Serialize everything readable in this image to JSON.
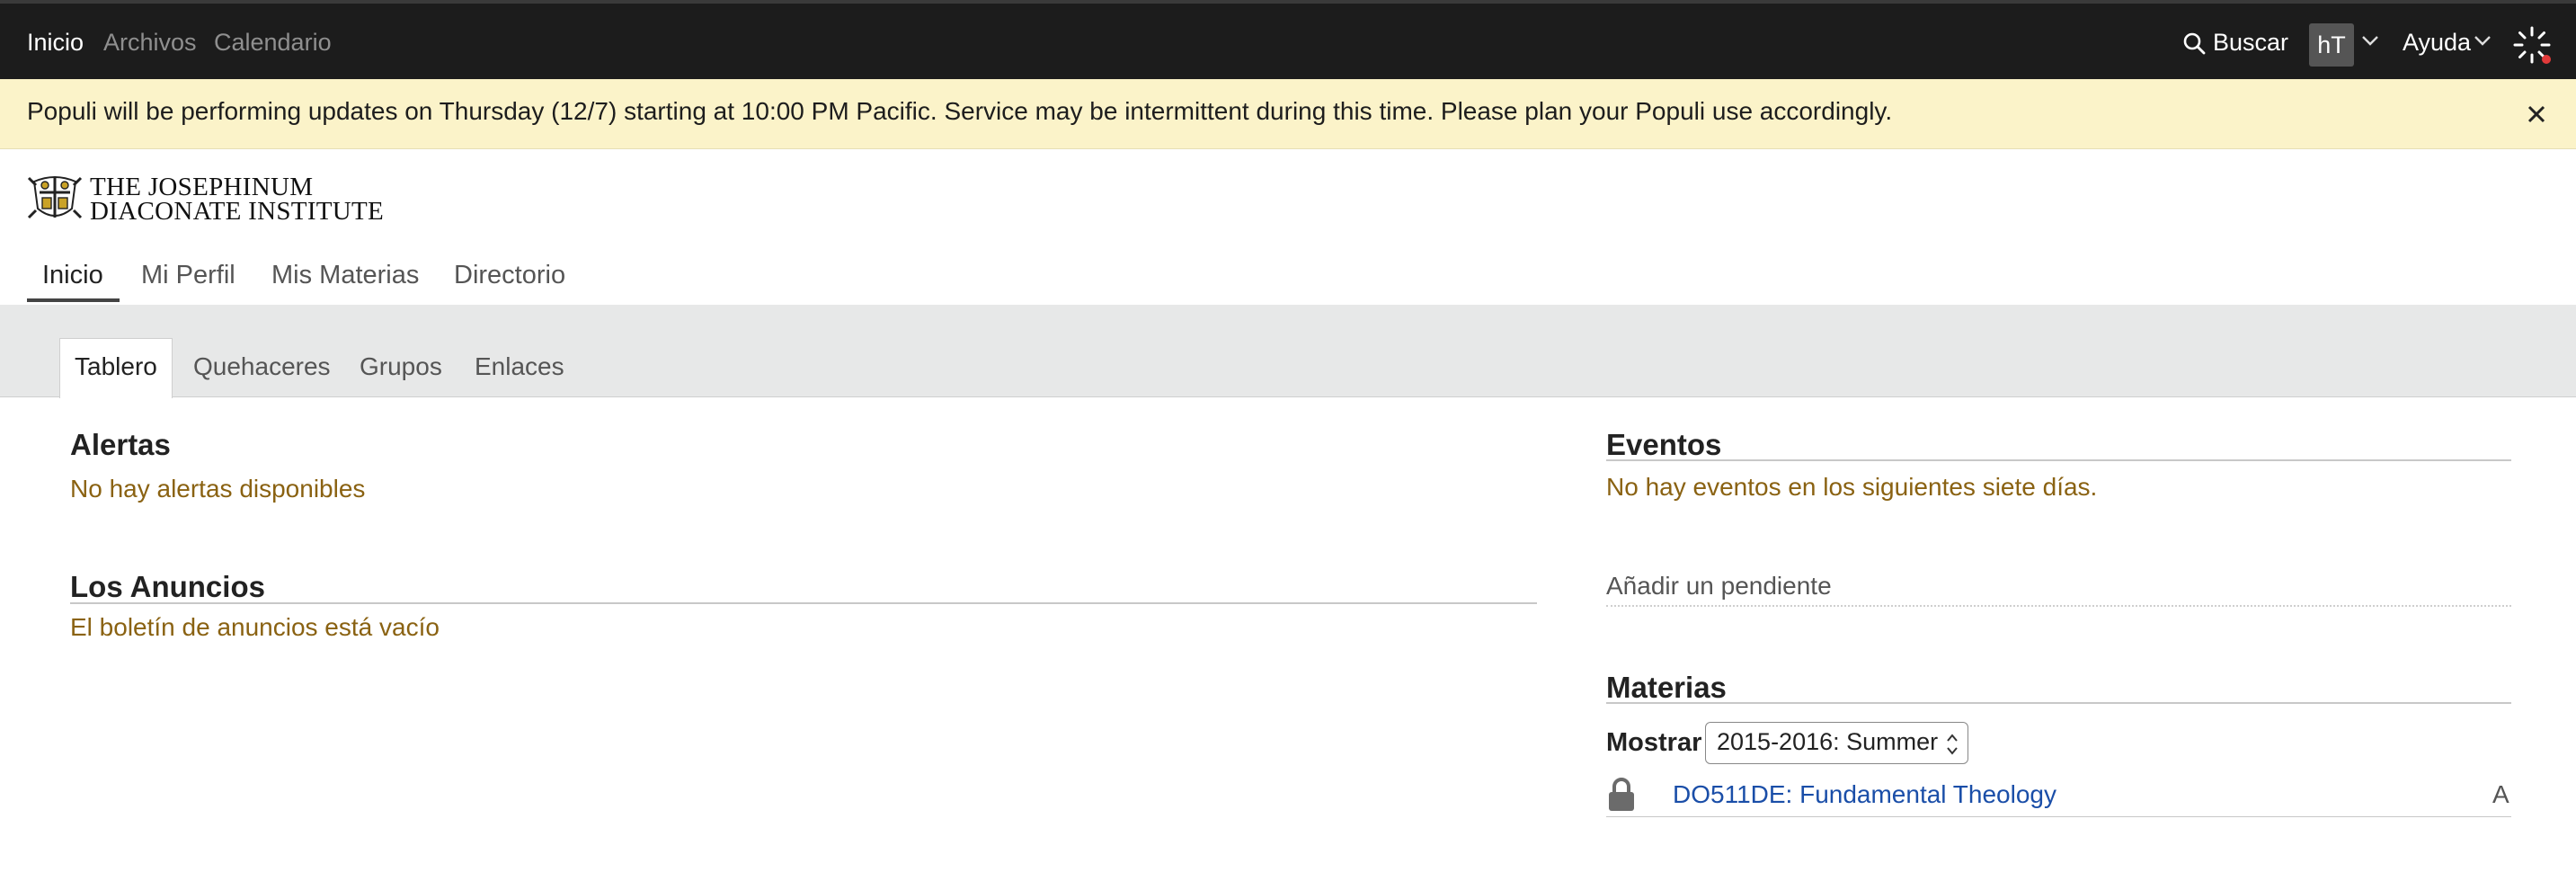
{
  "topbar": {
    "nav": [
      "Inicio",
      "Archivos",
      "Calendario"
    ],
    "search_label": "Buscar",
    "avatar_initials": "hT",
    "help_label": "Ayuda"
  },
  "banner": {
    "message": "Populi will be performing updates on Thursday (12/7) starting at 10:00 PM Pacific. Service may be intermittent during this time. Please plan your Populi use accordingly."
  },
  "logo": {
    "line1": "THE JOSEPHINUM",
    "line2": "DIACONATE INSTITUTE"
  },
  "main_nav": [
    "Inicio",
    "Mi Perfil",
    "Mis Materias",
    "Directorio"
  ],
  "sub_tabs": [
    "Tablero",
    "Quehaceres",
    "Grupos",
    "Enlaces"
  ],
  "alerts": {
    "title": "Alertas",
    "empty": "No hay alertas disponibles"
  },
  "announcements": {
    "title": "Los Anuncios",
    "empty": "El boletín de anuncios está vacío"
  },
  "events": {
    "title": "Eventos",
    "empty": "No hay eventos en los siguientes siete días."
  },
  "todo": {
    "add_label": "Añadir un pendiente"
  },
  "courses": {
    "title": "Materias",
    "show_label": "Mostrar",
    "term_selected": "2015-2016: Summer",
    "items": [
      {
        "name": "DO511DE: Fundamental Theology",
        "grade": "A"
      }
    ]
  },
  "colors": {
    "topbar_bg": "#1c1c1c",
    "banner_bg": "#fbf3c9",
    "empty_text": "#8a6212",
    "link": "#1a4ea8"
  },
  "icons": [
    "search-icon",
    "chevron-down-icon",
    "close-icon",
    "lock-icon",
    "spinner-icon",
    "select-arrows-icon",
    "crest-logo"
  ]
}
